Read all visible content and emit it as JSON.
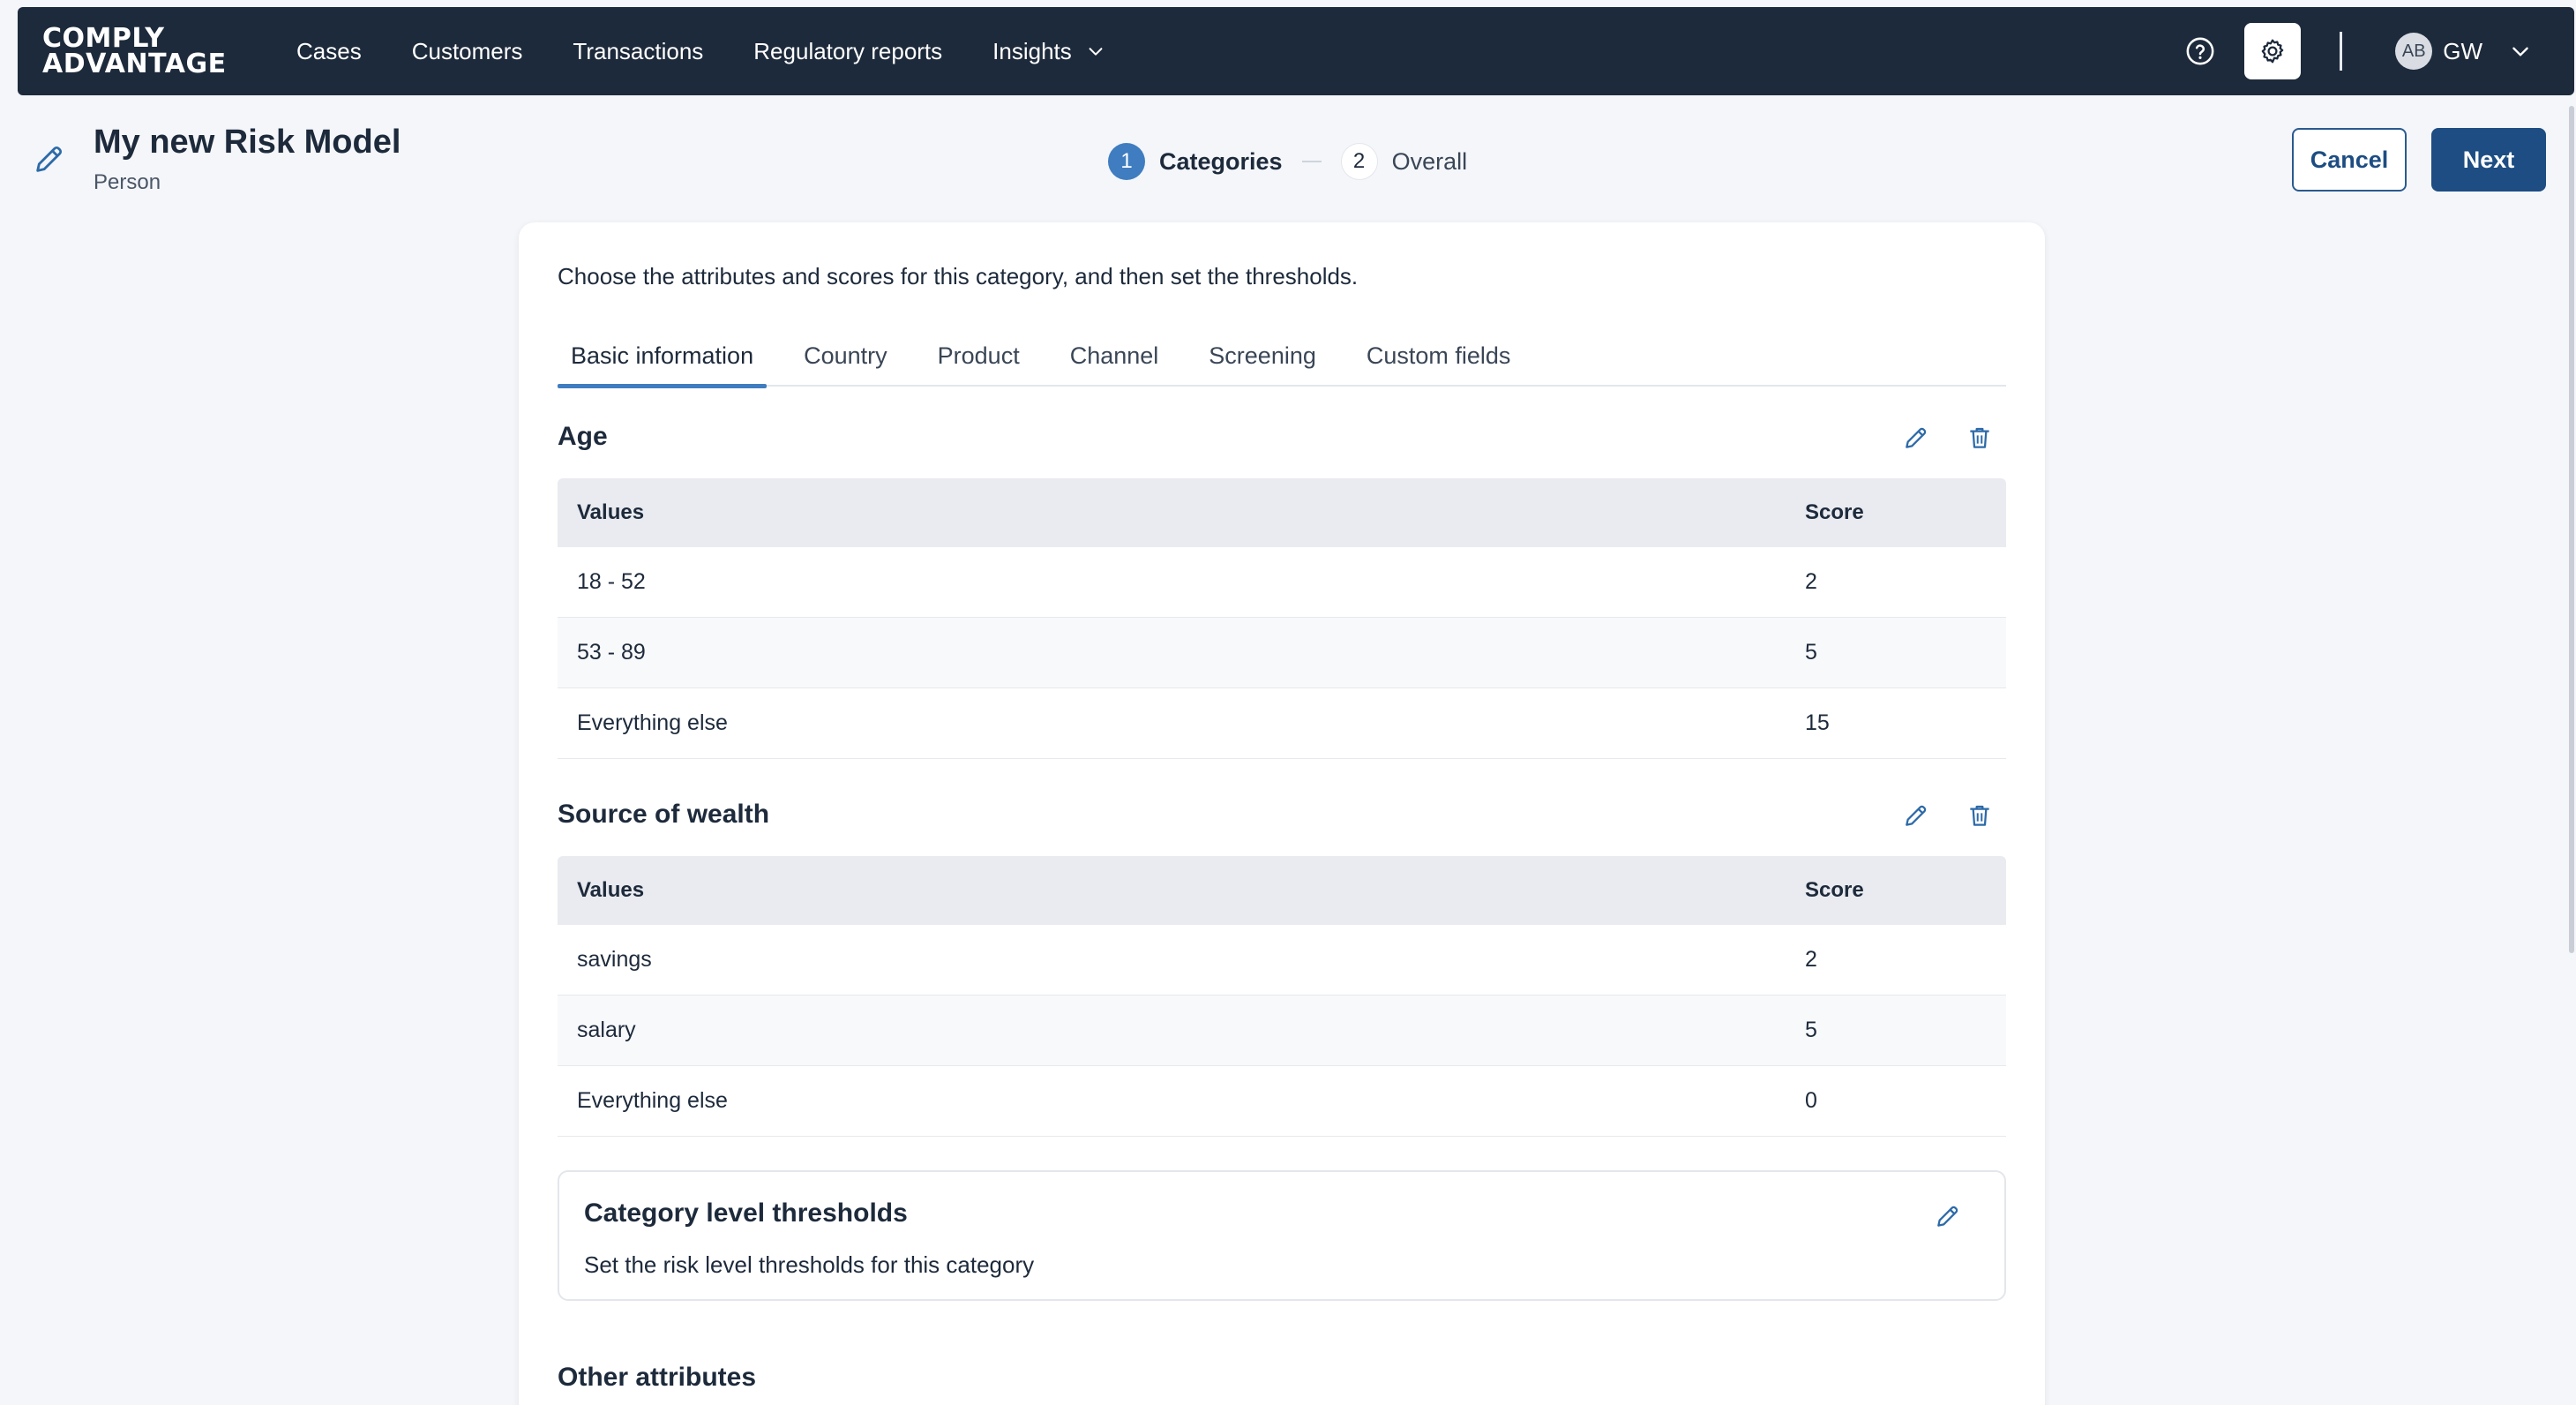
{
  "brand": {
    "line1": "COMPLY",
    "line2": "ADVANTAGE"
  },
  "nav": {
    "items": [
      {
        "label": "Cases"
      },
      {
        "label": "Customers"
      },
      {
        "label": "Transactions"
      },
      {
        "label": "Regulatory reports"
      },
      {
        "label": "Insights"
      }
    ],
    "help_icon": "help-circle-icon",
    "settings_icon": "gear-icon",
    "avatar_initials": "AB",
    "user_initials": "GW"
  },
  "header": {
    "title": "My new Risk Model",
    "subtitle": "Person",
    "cancel_label": "Cancel",
    "next_label": "Next"
  },
  "stepper": [
    {
      "num": "1",
      "label": "Categories",
      "active": true
    },
    {
      "num": "2",
      "label": "Overall",
      "active": false
    }
  ],
  "main": {
    "intro": "Choose the attributes and scores for this category, and then set the thresholds.",
    "tabs": [
      {
        "label": "Basic information",
        "active": true
      },
      {
        "label": "Country"
      },
      {
        "label": "Product"
      },
      {
        "label": "Channel"
      },
      {
        "label": "Screening"
      },
      {
        "label": "Custom fields"
      }
    ],
    "sections": [
      {
        "title": "Age",
        "columns": {
          "values": "Values",
          "score": "Score"
        },
        "rows": [
          {
            "value": "18 - 52",
            "score": "2"
          },
          {
            "value": "53 - 89",
            "score": "5"
          },
          {
            "value": "Everything else",
            "score": "15"
          }
        ]
      },
      {
        "title": "Source of wealth",
        "columns": {
          "values": "Values",
          "score": "Score"
        },
        "rows": [
          {
            "value": "savings",
            "score": "2"
          },
          {
            "value": "salary",
            "score": "5"
          },
          {
            "value": "Everything else",
            "score": "0"
          }
        ]
      }
    ],
    "thresholds": {
      "title": "Category level thresholds",
      "description": "Set the risk level thresholds for this category"
    },
    "other_title": "Other attributes"
  },
  "colors": {
    "nav_bg": "#1d2a3b",
    "primary": "#1d4d82",
    "accent": "#3f7dc0",
    "page_bg": "#f4f6fa"
  }
}
